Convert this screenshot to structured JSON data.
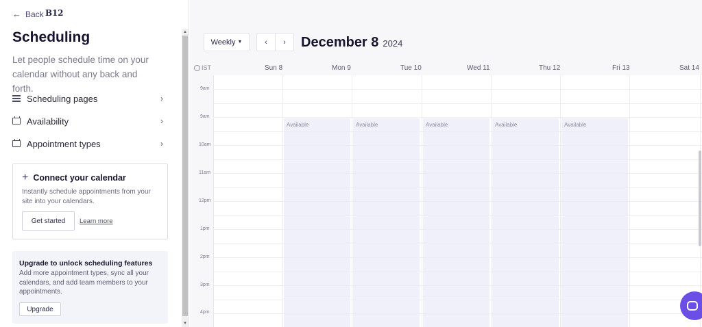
{
  "sidebar": {
    "back_label": "Back",
    "logo": "B12",
    "title": "Scheduling",
    "subtitle": "Let people schedule time on your calendar without any back and forth.",
    "nav": [
      {
        "label": "Scheduling pages",
        "icon": "list-icon"
      },
      {
        "label": "Availability",
        "icon": "calendar-icon"
      },
      {
        "label": "Appointment types",
        "icon": "calendar-icon"
      }
    ],
    "connect_card": {
      "title": "Connect your calendar",
      "text": "Instantly schedule appointments from your site into your calendars.",
      "button": "Get started",
      "link": "Learn more"
    },
    "upgrade_card": {
      "title": "Upgrade to unlock scheduling features",
      "text": "Add more appointment types, sync all your calendars, and add team members to your appointments.",
      "button": "Upgrade"
    }
  },
  "toolbar": {
    "view": "Weekly",
    "prev_label": "‹",
    "next_label": "›",
    "date_main": "December 8",
    "date_year": "2024"
  },
  "calendar": {
    "timezone": "IST",
    "days": [
      "Sun 8",
      "Mon 9",
      "Tue 10",
      "Wed 11",
      "Thu 12",
      "Fri 13",
      "Sat 14"
    ],
    "times": [
      "9am",
      "9am",
      "10am",
      "11am",
      "12pm",
      "1pm",
      "2pm",
      "3pm",
      "4pm"
    ],
    "available_label": "Available",
    "available_days": [
      "Mon 9",
      "Tue 10",
      "Wed 11",
      "Thu 12",
      "Fri 13"
    ]
  },
  "colors": {
    "accent": "#6b4ee6",
    "available_bg": "#f0f0fb"
  }
}
